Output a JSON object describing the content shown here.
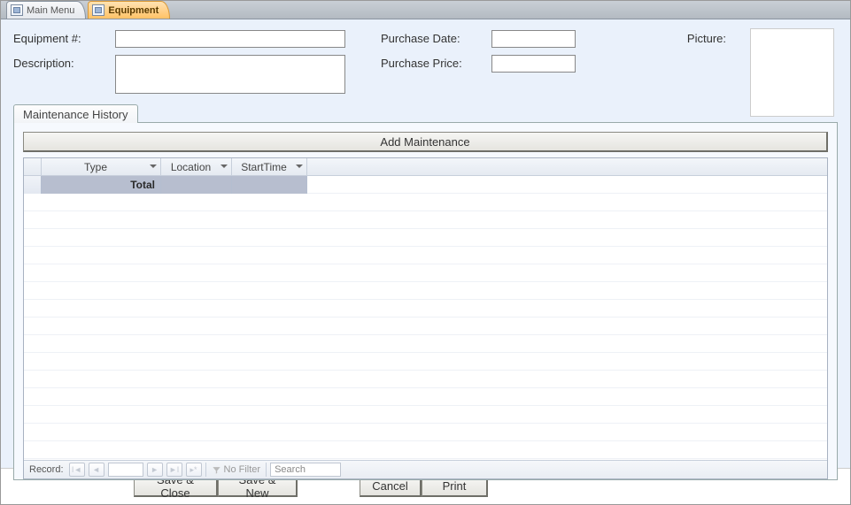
{
  "tabs": {
    "main_menu": "Main Menu",
    "equipment": "Equipment"
  },
  "fields": {
    "equipment_num_label": "Equipment #:",
    "equipment_num_value": "",
    "description_label": "Description:",
    "description_value": "",
    "purchase_date_label": "Purchase Date:",
    "purchase_date_value": "",
    "purchase_price_label": "Purchase Price:",
    "purchase_price_value": "",
    "picture_label": "Picture:"
  },
  "subtab": {
    "label": "Maintenance History",
    "add_button": "Add Maintenance",
    "columns": {
      "type": "Type",
      "location": "Location",
      "start_time": "StartTime"
    },
    "total_label": "Total"
  },
  "recnav": {
    "label": "Record:",
    "no_filter": "No Filter",
    "search_placeholder": "Search"
  },
  "footer": {
    "save_close": "Save & Close",
    "save_new": "Save & New",
    "cancel": "Cancel",
    "print": "Print"
  }
}
